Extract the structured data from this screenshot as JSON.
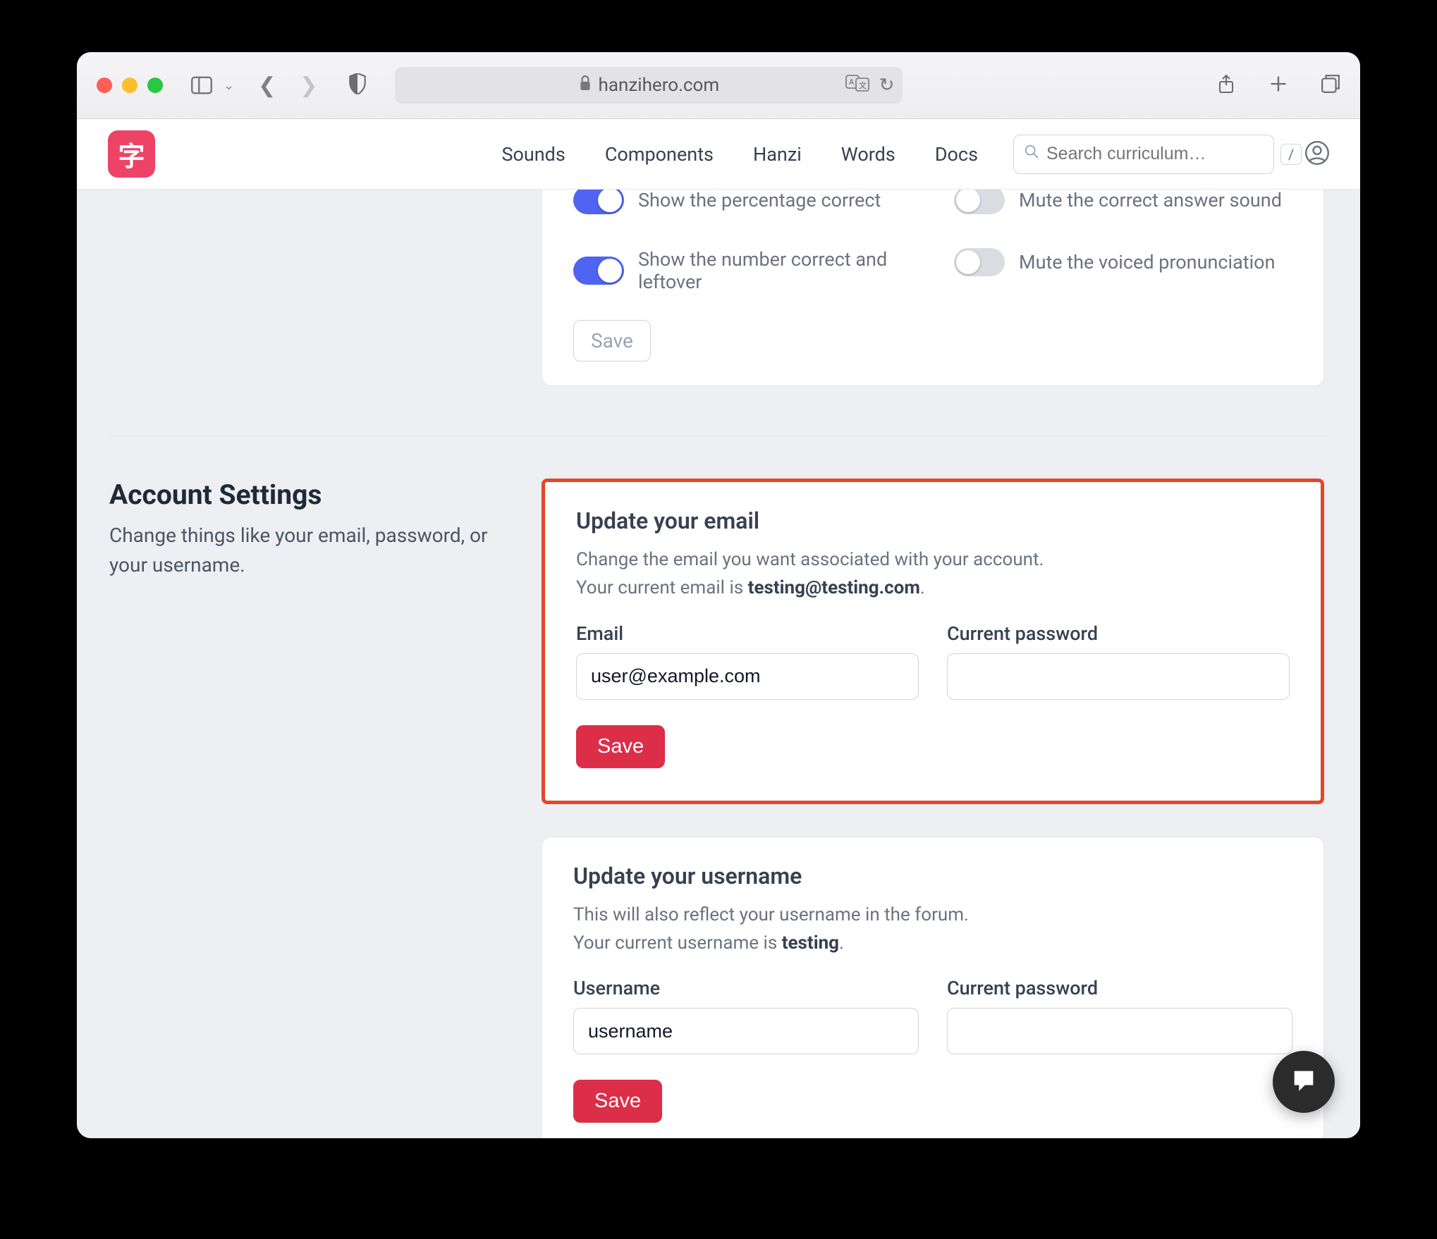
{
  "browser": {
    "url_host": "hanzihero.com"
  },
  "nav": {
    "logo_char": "字",
    "links": [
      "Sounds",
      "Components",
      "Hanzi",
      "Words",
      "Docs"
    ],
    "search_placeholder": "Search curriculum…",
    "shortcut_key": "/"
  },
  "review_settings": {
    "toggles_left": [
      {
        "label": "Show the percentage correct",
        "on": true
      },
      {
        "label": "Show the number correct and leftover",
        "on": true
      }
    ],
    "toggles_right": [
      {
        "label": "Mute the correct answer sound",
        "on": false
      },
      {
        "label": "Mute the voiced pronunciation",
        "on": false
      }
    ],
    "save_label": "Save"
  },
  "account_section": {
    "heading": "Account Settings",
    "sub": "Change things like your email, password, or your username."
  },
  "email_card": {
    "title": "Update your email",
    "desc1": "Change the email you want associated with your account.",
    "desc2_pre": "Your current email is ",
    "current_email": "testing@testing.com",
    "desc2_post": ".",
    "email_label": "Email",
    "email_value": "user@example.com",
    "pw_label": "Current password",
    "pw_value": "",
    "save_label": "Save"
  },
  "username_card": {
    "title": "Update your username",
    "desc1": "This will also reflect your username in the forum.",
    "desc2_pre": "Your current username is ",
    "current_username": "testing",
    "desc2_post": ".",
    "username_label": "Username",
    "username_value": "username",
    "pw_label": "Current password",
    "pw_value": "",
    "save_label": "Save"
  }
}
